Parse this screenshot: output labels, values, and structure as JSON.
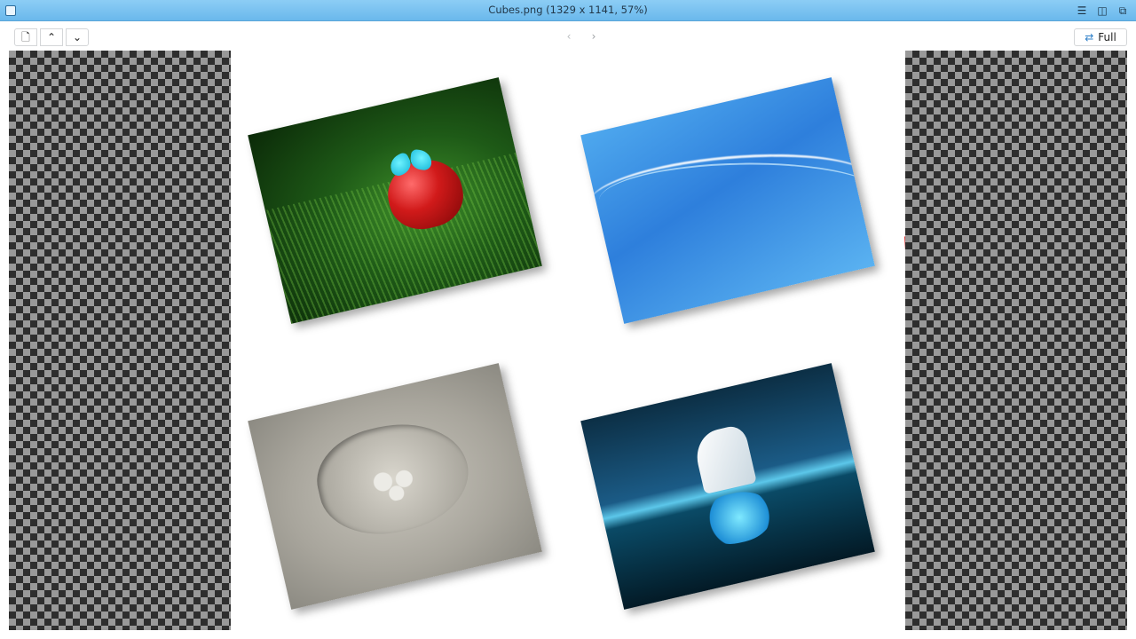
{
  "window": {
    "title": "Cubes.png (1329 x 1141, 57%)"
  },
  "titlebar": {
    "app_icon": "window-icon",
    "menu_icon": "hamburger-menu-icon",
    "maximize_icon": "maximize-icon",
    "restore_icon": "restore-icon"
  },
  "toolbar": {
    "document_icon": "document-icon",
    "up_icon": "chevron-up-icon",
    "down_icon": "chevron-down-icon",
    "prev_icon": "chevron-left-icon",
    "next_icon": "chevron-right-icon",
    "fit_label": "Full",
    "fit_icon": "swap-arrows-icon"
  },
  "colors": {
    "titlebar": "#7cc2f0",
    "accent": "#2d7fc8",
    "cursor": "#d81c1c"
  }
}
